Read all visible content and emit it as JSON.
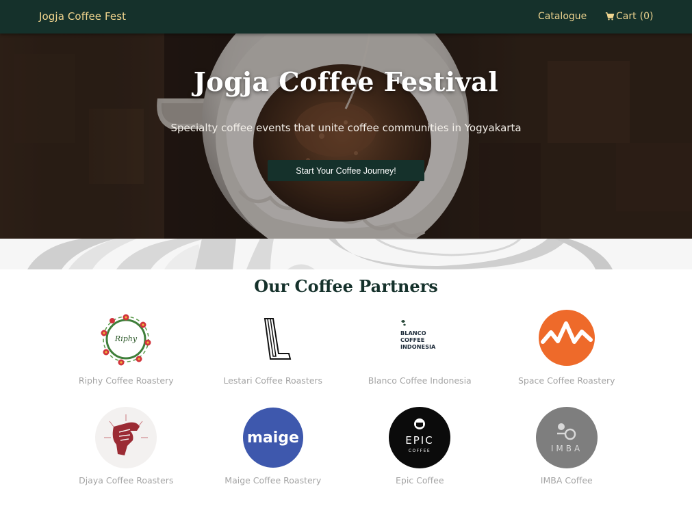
{
  "navbar": {
    "brand": "Jogja Coffee Fest",
    "catalogue_label": "Catalogue",
    "cart_label": "Cart",
    "cart_count": "(0)",
    "cart_icon": "shopping-cart-icon"
  },
  "hero": {
    "title": "Jogja Coffee Festival",
    "subtitle": "Specialty coffee events that unite coffee communities in Yogyakarta",
    "cta_label": "Start Your Coffee Journey!"
  },
  "partners": {
    "title": "Our Coffee Partners",
    "items": [
      {
        "name": "Riphy Coffee Roastery",
        "logo": "riphy-floral-wreath-logo",
        "logo_text": "Riphy"
      },
      {
        "name": "Lestari Coffee Roasters",
        "logo": "lestari-l-logo",
        "logo_text": "L"
      },
      {
        "name": "Blanco Coffee Indonesia",
        "logo": "blanco-text-logo",
        "logo_text": "BLANCO COFFEE INDONESIA"
      },
      {
        "name": "Space Coffee Roastery",
        "logo": "space-orange-wave-logo",
        "logo_text": ""
      },
      {
        "name": "Djaya Coffee Roasters",
        "logo": "djaya-hand-logo",
        "logo_text": ""
      },
      {
        "name": "Maige Coffee Roastery",
        "logo": "maige-blue-circle-logo",
        "logo_text": "maige"
      },
      {
        "name": "Epic Coffee",
        "logo": "epic-black-circle-logo",
        "logo_text": "EPIC",
        "logo_subtext": "COFFEE"
      },
      {
        "name": "IMBA Coffee",
        "logo": "imba-gray-circle-logo",
        "logo_text": "IMBA"
      }
    ]
  },
  "colors": {
    "nav_bg": "#15312b",
    "brand_gold": "#f1d58e",
    "partner_title": "#15312b",
    "partner_name": "#a4a4a4",
    "space_orange": "#ee6a2a",
    "maige_blue": "#3e58ad",
    "imba_gray": "#7e7e7e"
  }
}
